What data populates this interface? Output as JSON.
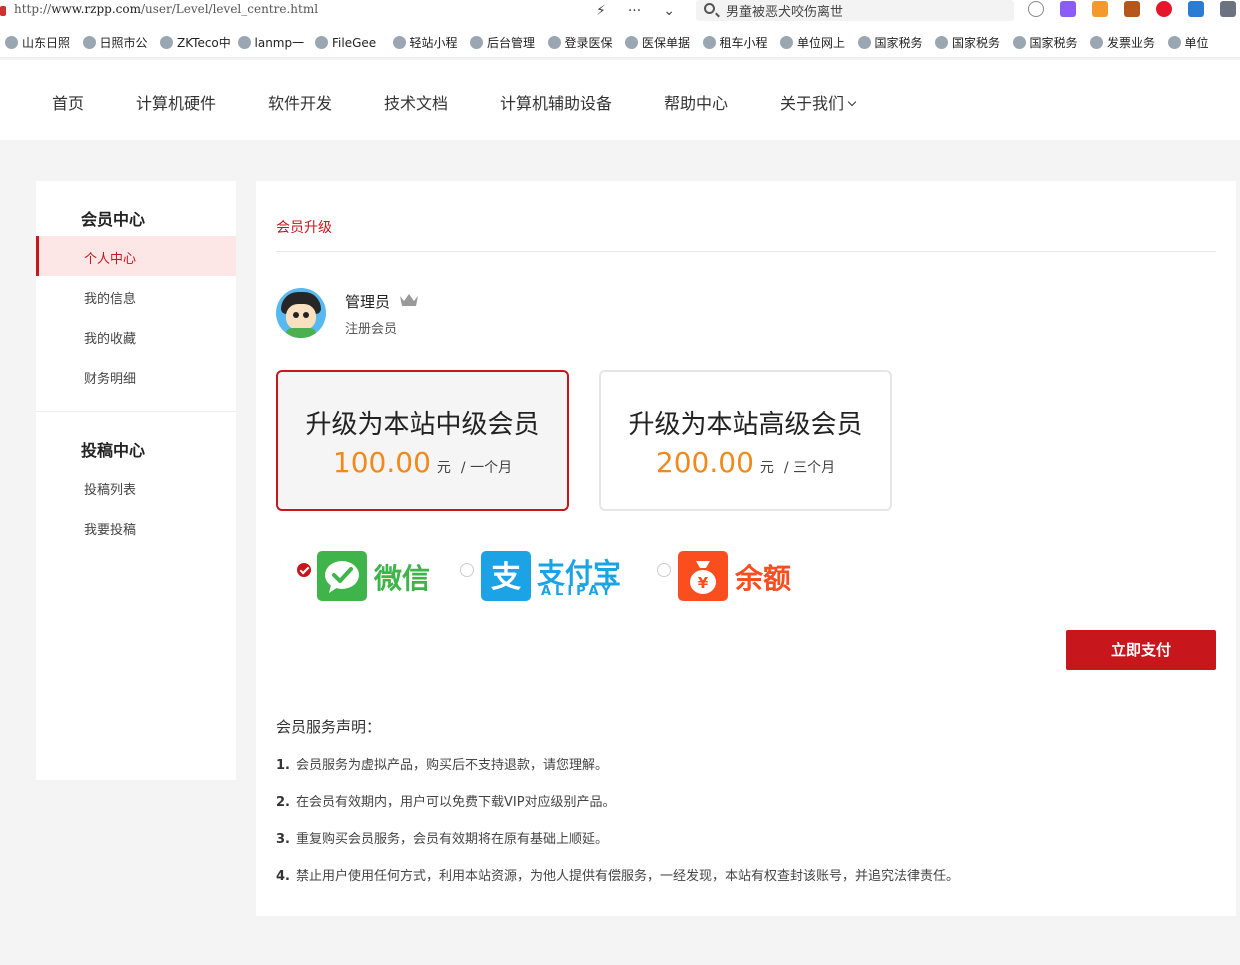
{
  "browser": {
    "url_scheme": "http://",
    "url_host": "www.rzpp.com",
    "url_path": "/user/Level/level_centre.html",
    "search_text": "男童被恶犬咬伤离世"
  },
  "bookmarks": [
    {
      "label": "山东日照"
    },
    {
      "label": "日照市公"
    },
    {
      "label": "ZKTeco中"
    },
    {
      "label": "lanmp一"
    },
    {
      "label": "FileGee"
    },
    {
      "label": "轻站小程"
    },
    {
      "label": "后台管理"
    },
    {
      "label": "登录医保"
    },
    {
      "label": "医保单据"
    },
    {
      "label": "租车小程"
    },
    {
      "label": "单位网上"
    },
    {
      "label": "国家税务"
    },
    {
      "label": "国家税务"
    },
    {
      "label": "国家税务"
    },
    {
      "label": "发票业务"
    },
    {
      "label": "单位"
    }
  ],
  "nav": {
    "items": [
      "首页",
      "计算机硬件",
      "软件开发",
      "技术文档",
      "计算机辅助设备",
      "帮助中心",
      "关于我们"
    ]
  },
  "sidebar": {
    "member_heading": "会员中心",
    "member_items": [
      "个人中心",
      "我的信息",
      "我的收藏",
      "财务明细"
    ],
    "submit_heading": "投稿中心",
    "submit_items": [
      "投稿列表",
      "我要投稿"
    ]
  },
  "main": {
    "section_title": "会员升级",
    "user": {
      "name": "管理员",
      "role": "注册会员"
    },
    "plans": [
      {
        "title": "升级为本站中级会员",
        "price": "100.00",
        "unit": "元",
        "period": "/ 一个月",
        "selected": true
      },
      {
        "title": "升级为本站高级会员",
        "price": "200.00",
        "unit": "元",
        "period": "/ 三个月",
        "selected": false
      }
    ],
    "payment": {
      "wechat": "微信",
      "alipay": "支付宝",
      "alipay_en": "ALIPAY",
      "balance": "余额",
      "selected": "wechat"
    },
    "pay_button": "立即支付",
    "notice_title": "会员服务声明：",
    "notices": [
      {
        "n": "1.",
        "text": "会员服务为虚拟产品，购买后不支持退款，请您理解。"
      },
      {
        "n": "2.",
        "text": "在会员有效期内，用户可以免费下载VIP对应级别产品。"
      },
      {
        "n": "3.",
        "text": "重复购买会员服务，会员有效期将在原有基础上顺延。"
      },
      {
        "n": "4.",
        "text": "禁止用户使用任何方式，利用本站资源，为他人提供有偿服务，一经发现，本站有权查封该账号，并追究法律责任。"
      }
    ]
  },
  "colors": {
    "accent": "#c8161d",
    "price": "#f08a1c",
    "wechat": "#3fb44a",
    "alipay": "#1ba3e6",
    "balance": "#fb4e1e"
  }
}
